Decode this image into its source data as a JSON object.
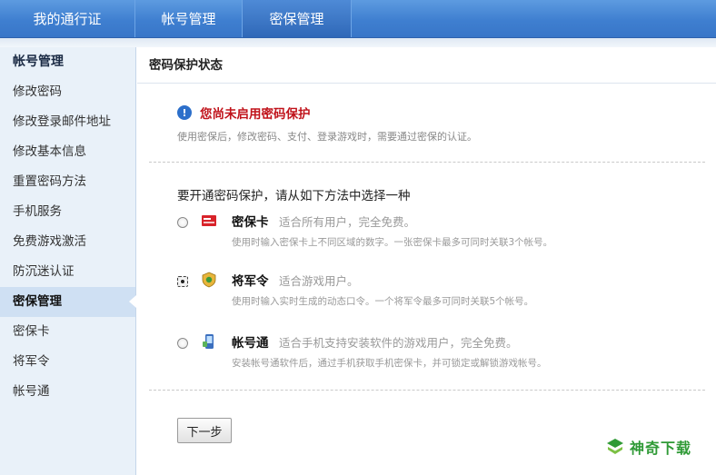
{
  "nav": {
    "tabs": [
      {
        "label": "我的通行证"
      },
      {
        "label": "帐号管理"
      },
      {
        "label": "密保管理"
      }
    ]
  },
  "sidebar": {
    "section1_title": "帐号管理",
    "items": [
      {
        "label": "修改密码"
      },
      {
        "label": "修改登录邮件地址"
      },
      {
        "label": "修改基本信息"
      },
      {
        "label": "重置密码方法"
      },
      {
        "label": "手机服务"
      },
      {
        "label": "免费游戏激活"
      },
      {
        "label": "防沉迷认证"
      }
    ],
    "section2_title": "密保管理",
    "items2": [
      {
        "label": "密保卡"
      },
      {
        "label": "将军令"
      },
      {
        "label": "帐号通"
      }
    ]
  },
  "main": {
    "heading": "密码保护状态",
    "status_title": "您尚未启用密码保护",
    "status_desc": "使用密保后，修改密码、支付、登录游戏时，需要通过密保的认证。",
    "choose_text": "要开通密码保护，请从如下方法中选择一种",
    "options": [
      {
        "name": "密保卡",
        "tag": "适合所有用户，完全免费。",
        "desc": "使用时输入密保卡上不同区域的数字。一张密保卡最多可同时关联3个帐号。",
        "checked": false
      },
      {
        "name": "将军令",
        "tag": "适合游戏用户。",
        "desc": "使用时输入实时生成的动态口令。一个将军令最多可同时关联5个帐号。",
        "checked": true
      },
      {
        "name": "帐号通",
        "tag": "适合手机支持安装软件的游戏用户，完全免费。",
        "desc": "安装帐号通软件后，通过手机获取手机密保卡，并可锁定或解锁游戏帐号。",
        "checked": false
      }
    ],
    "next_label": "下一步"
  },
  "watermark": {
    "text": "神奇下载"
  },
  "colors": {
    "nav": "#3f7fd0",
    "warning": "#c0121a",
    "sidebar_bg": "#e9f1f9"
  }
}
